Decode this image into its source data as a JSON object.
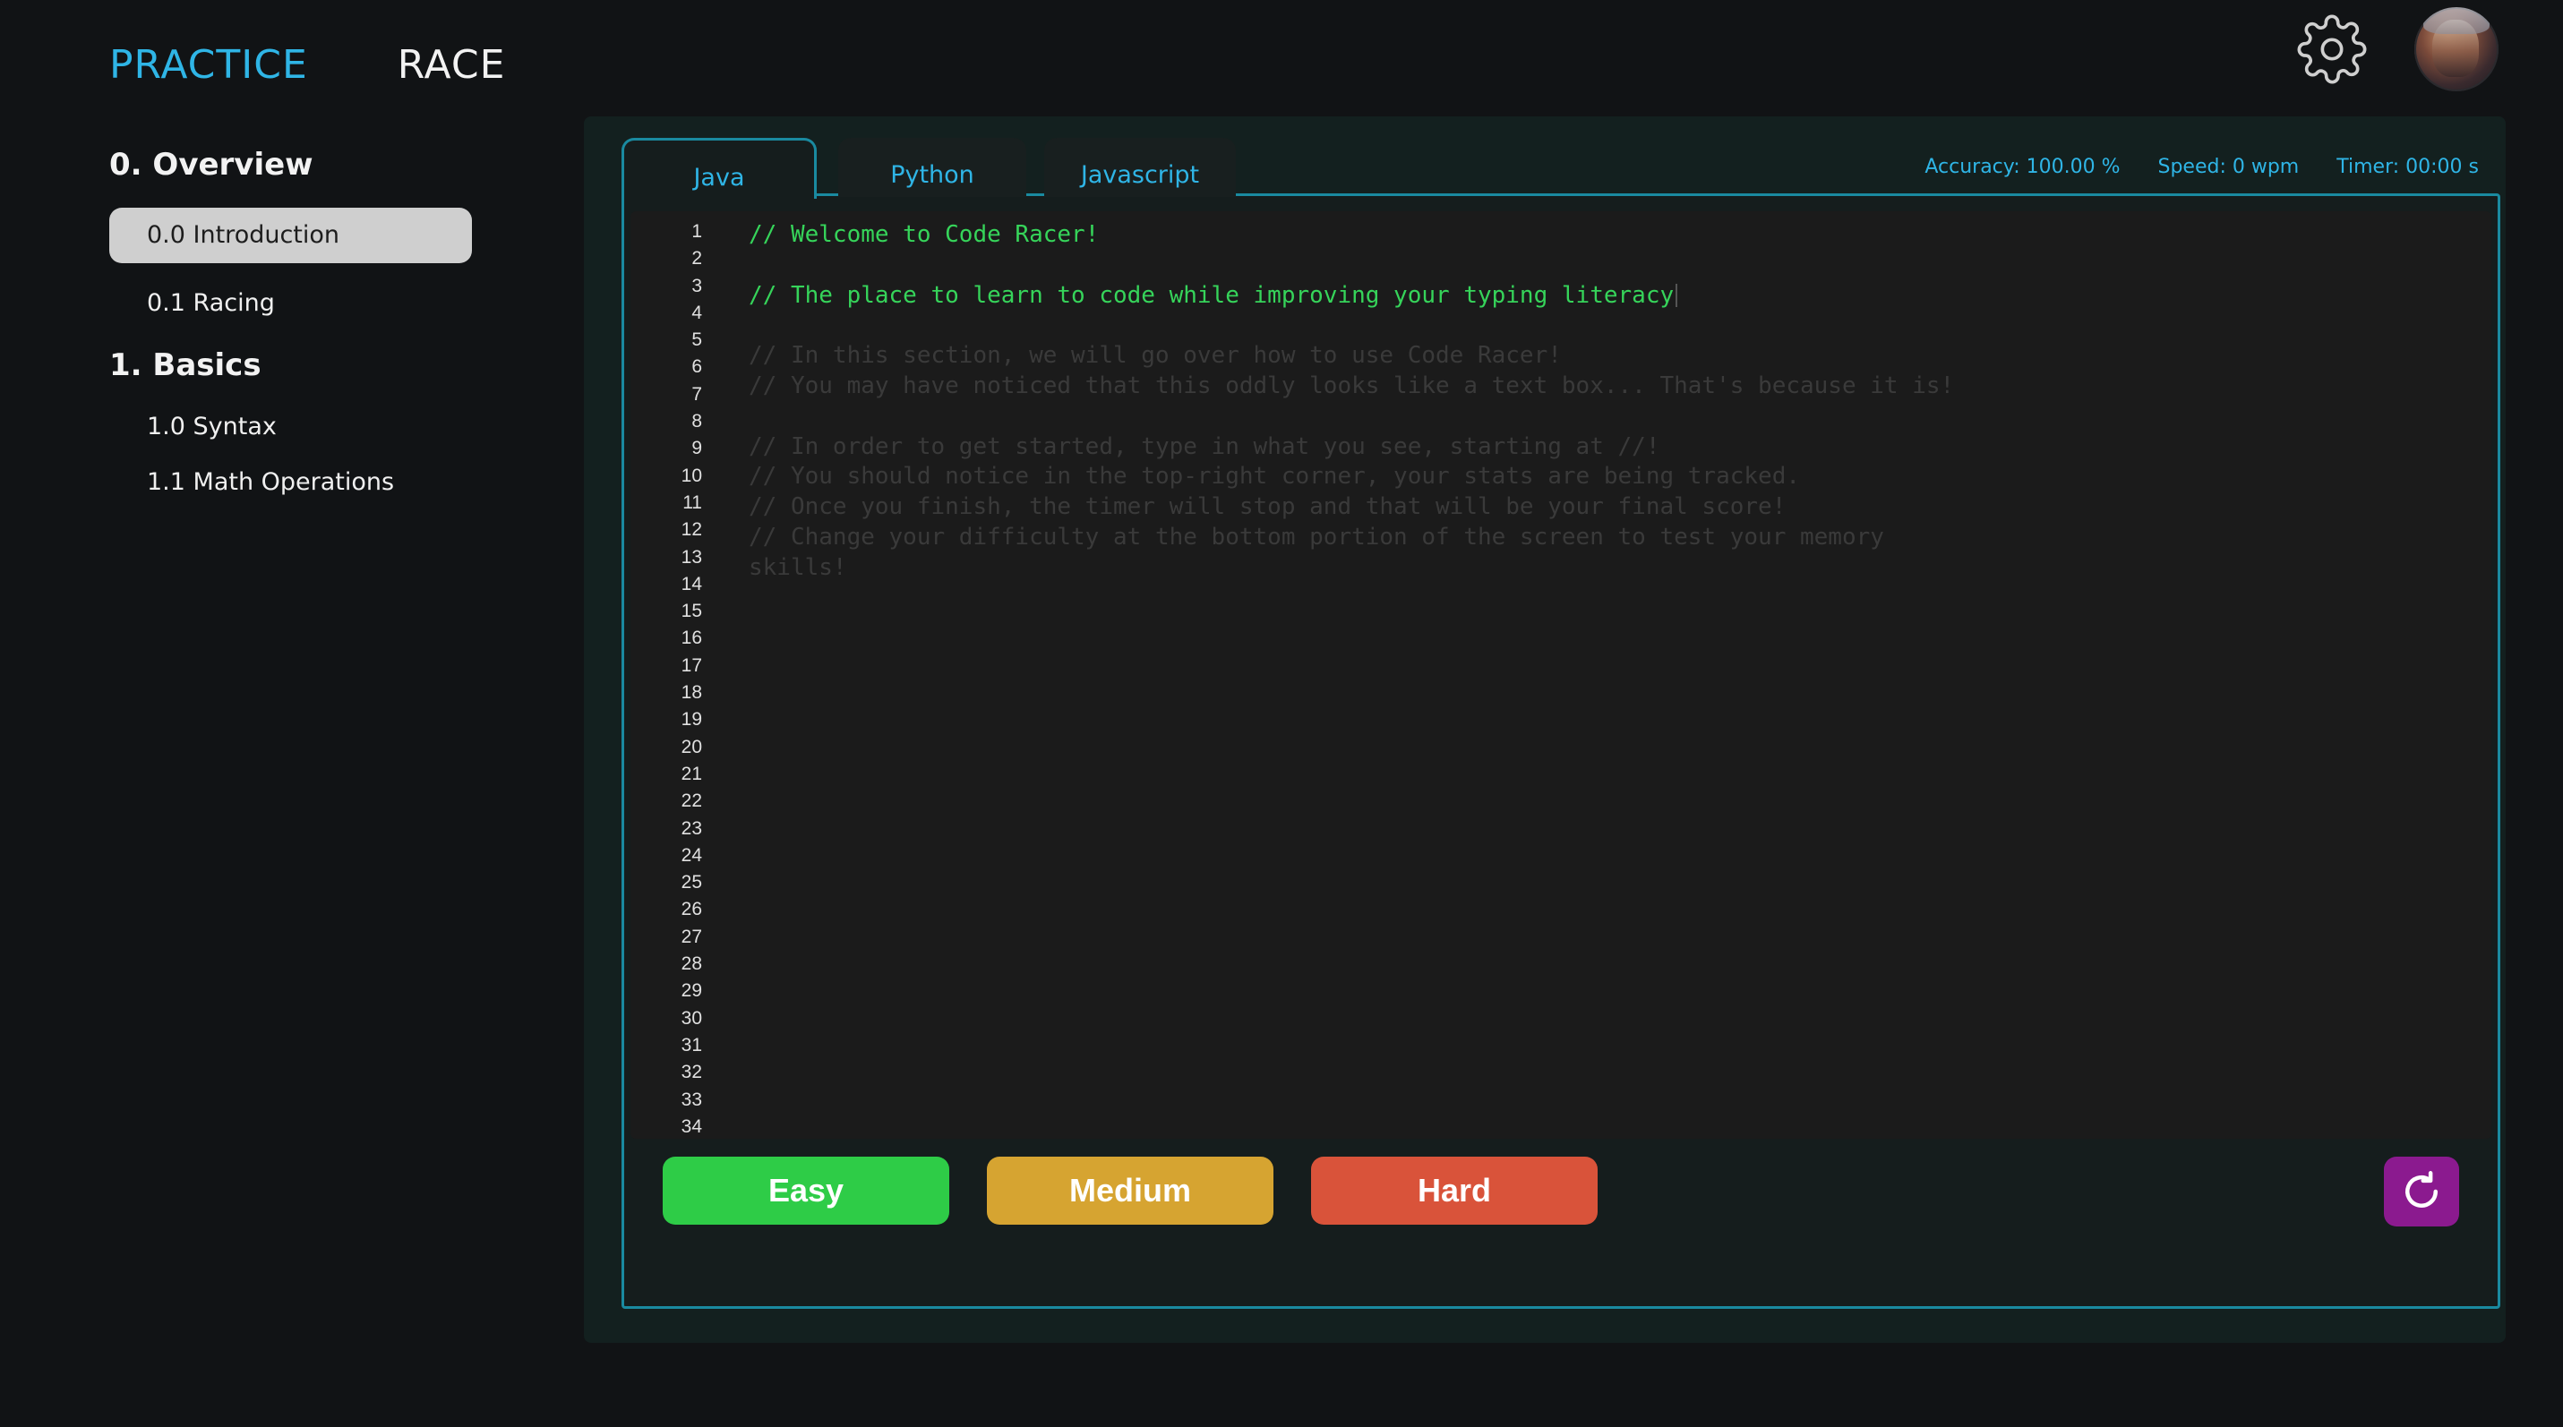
{
  "nav": {
    "practice": "PRACTICE",
    "race": "RACE"
  },
  "icons": {
    "settings": "gear-icon",
    "avatar": "avatar",
    "reset": "refresh-icon"
  },
  "sidebar": {
    "sections": [
      {
        "title": "0. Overview",
        "items": [
          "0.0 Introduction",
          "0.1 Racing"
        ]
      },
      {
        "title": "1. Basics",
        "items": [
          "1.0 Syntax",
          "1.1 Math Operations"
        ]
      }
    ],
    "selected": "0.0 Introduction"
  },
  "tabs": [
    {
      "label": "Java",
      "active": true
    },
    {
      "label": "Python",
      "active": false
    },
    {
      "label": "Javascript",
      "active": false
    }
  ],
  "stats": {
    "accuracy": "Accuracy: 100.00 %",
    "speed": "Speed: 0 wpm",
    "timer": "Timer: 00:00 s"
  },
  "editor": {
    "line_count": 34,
    "lines": [
      {
        "text": "// Welcome to Code Racer!",
        "state": "typed"
      },
      {
        "text": "",
        "state": "ghost"
      },
      {
        "text": "// The place to learn to code while improving your typing literacy",
        "state": "typed"
      },
      {
        "text": "",
        "state": "ghost"
      },
      {
        "text": "// In this section, we will go over how to use Code Racer!",
        "state": "ghost"
      },
      {
        "text": "// You may have noticed that this oddly looks like a text box... That's because it is!",
        "state": "ghost"
      },
      {
        "text": "",
        "state": "ghost"
      },
      {
        "text": "// In order to get started, type in what you see, starting at //!",
        "state": "ghost"
      },
      {
        "text": "// You should notice in the top-right corner, your stats are being tracked.",
        "state": "ghost"
      },
      {
        "text": "// Once you finish, the timer will stop and that will be your final score!",
        "state": "ghost"
      },
      {
        "text": "// Change your difficulty at the bottom portion of the screen to test your memory",
        "state": "ghost"
      },
      {
        "text": "skills!",
        "state": "ghost"
      }
    ]
  },
  "difficulty": {
    "easy": "Easy",
    "medium": "Medium",
    "hard": "Hard"
  },
  "colors": {
    "accent": "#2fb5e6",
    "typed": "#36d45a",
    "easy": "#2ecc47",
    "medium": "#d6a431",
    "hard": "#d9533a",
    "reset": "#8b1a8f"
  }
}
